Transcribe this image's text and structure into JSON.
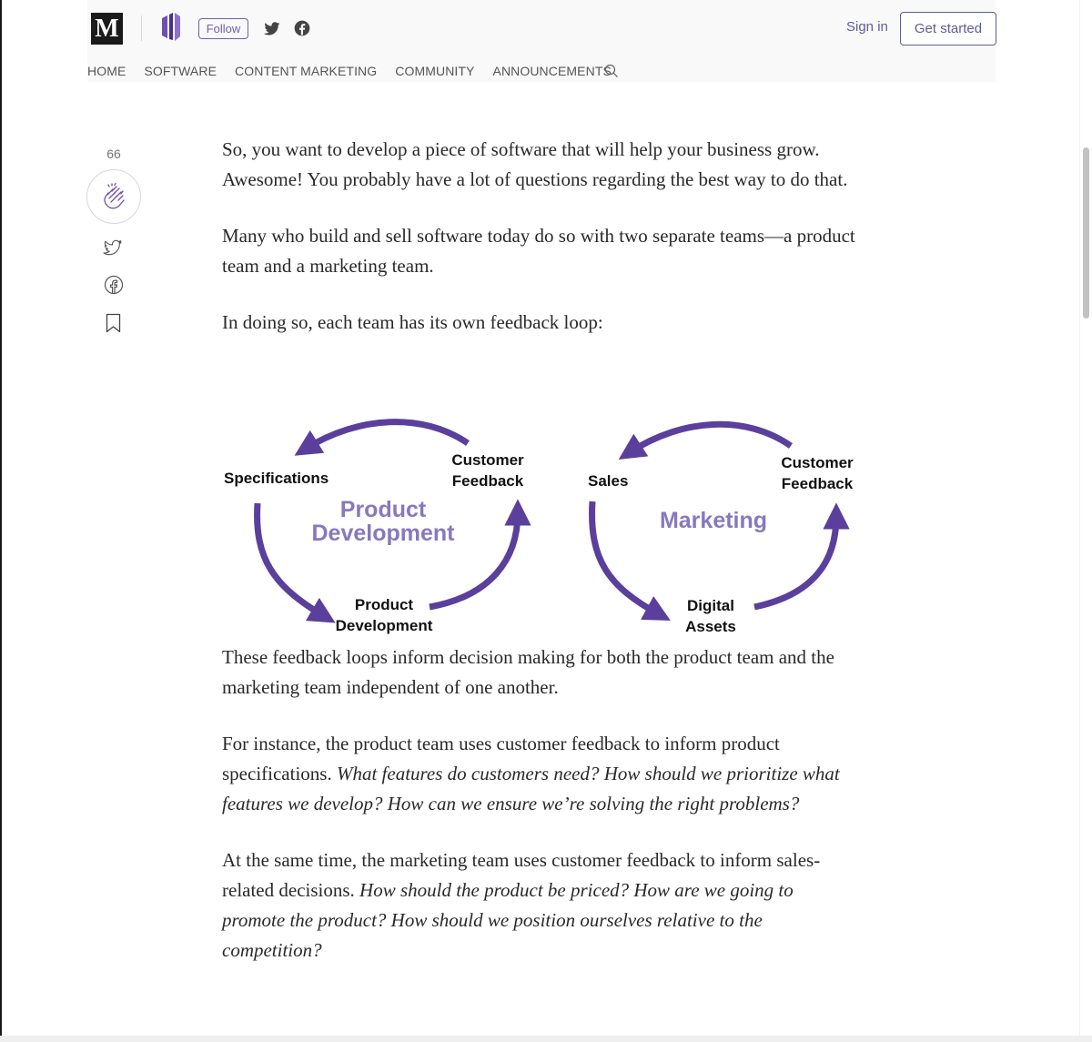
{
  "header": {
    "site_logo": "M",
    "follow_label": "Follow",
    "signin_label": "Sign in",
    "get_started_label": "Get started",
    "nav": [
      "HOME",
      "SOFTWARE",
      "CONTENT MARKETING",
      "COMMUNITY",
      "ANNOUNCEMENTS"
    ],
    "icons": [
      "medium-logo-icon",
      "publication-logo-icon",
      "twitter-icon",
      "facebook-icon",
      "search-icon"
    ]
  },
  "rail": {
    "clap_count": "66",
    "icons": [
      "clap-icon",
      "twitter-icon",
      "facebook-icon",
      "bookmark-icon"
    ]
  },
  "article": {
    "p1": "So, you want to develop a piece of software that will help your business grow. Awesome! You probably have a lot of questions regarding the best way to do that.",
    "p2": "Many who build and sell software today do so with two separate teams—a product team and a marketing team.",
    "p3": "In doing so, each team has its own feedback loop:",
    "p4": "These feedback loops inform decision making for both the product team and the marketing team independent of one another.",
    "p5_plain": "For instance, the product team uses customer feedback to inform product specifications. ",
    "p5_italic": "What features do customers need? How should we prioritize what features we develop? How can we ensure we’re solving the right problems?",
    "p6_plain": "At the same time, the marketing team uses customer feedback to inform sales-related decisions. ",
    "p6_italic": "How should the product be priced? How are we going to promote the product? How should we position ourselves relative to the competition?"
  },
  "figure": {
    "left": {
      "center": [
        "Product",
        "Development"
      ],
      "nodes": {
        "top_right": [
          "Customer",
          "Feedback"
        ],
        "left": [
          "Specifications"
        ],
        "bottom": [
          "Product",
          "Development"
        ]
      }
    },
    "right": {
      "center": [
        "Marketing"
      ],
      "nodes": {
        "top_right": [
          "Customer",
          "Feedback"
        ],
        "left": [
          "Sales"
        ],
        "bottom": [
          "Digital",
          "Assets"
        ]
      }
    }
  },
  "colors": {
    "accent": "#5b3f9c",
    "center_label": "#8878bd",
    "follow": "#6d61b4",
    "signin": "#5b5d99"
  }
}
